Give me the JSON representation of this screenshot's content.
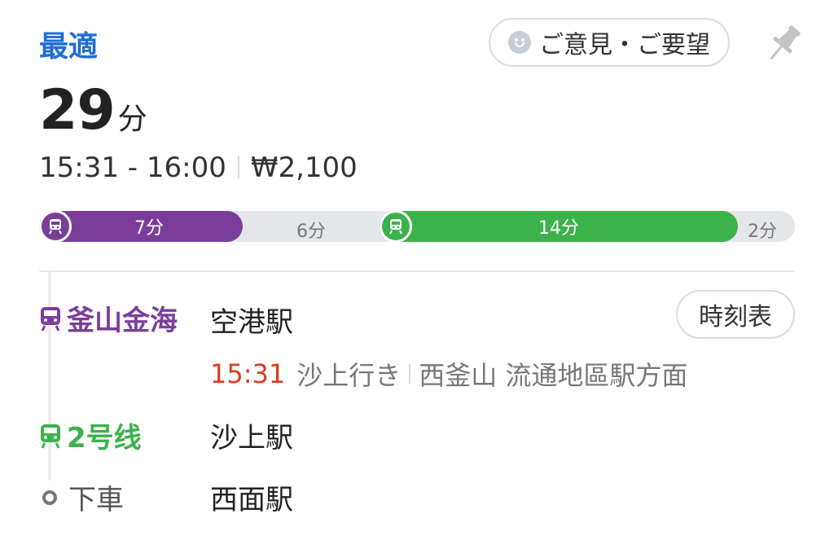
{
  "header": {
    "route_label": "最適",
    "feedback_label": "ご意見・ご要望"
  },
  "summary": {
    "duration_value": "29",
    "duration_unit": "分",
    "time_range": "15:31 - 16:00",
    "fare": "₩2,100"
  },
  "timeline": {
    "segments": [
      {
        "label": "7分",
        "mode": "train",
        "color": "#7a3e9a"
      },
      {
        "label": "6分",
        "mode": "walk"
      },
      {
        "label": "14分",
        "mode": "train",
        "color": "#3cb24a"
      },
      {
        "label": "2分",
        "mode": "walk"
      }
    ]
  },
  "steps": {
    "line1": {
      "name": "釜山金海",
      "station": "空港駅",
      "color": "#7a3e9a"
    },
    "timetable_label": "時刻表",
    "departure": {
      "time": "15:31",
      "destination": "沙上行き",
      "direction": "西釜山 流通地區駅方面"
    },
    "line2": {
      "name": "2号线",
      "station": "沙上駅",
      "color": "#3cb24a"
    },
    "alight": {
      "name": "下車",
      "station": "西面駅"
    }
  },
  "icons": {
    "train": "train-icon",
    "smile": "smile-icon",
    "pin": "pin-icon",
    "stop": "stop-circle-icon"
  }
}
